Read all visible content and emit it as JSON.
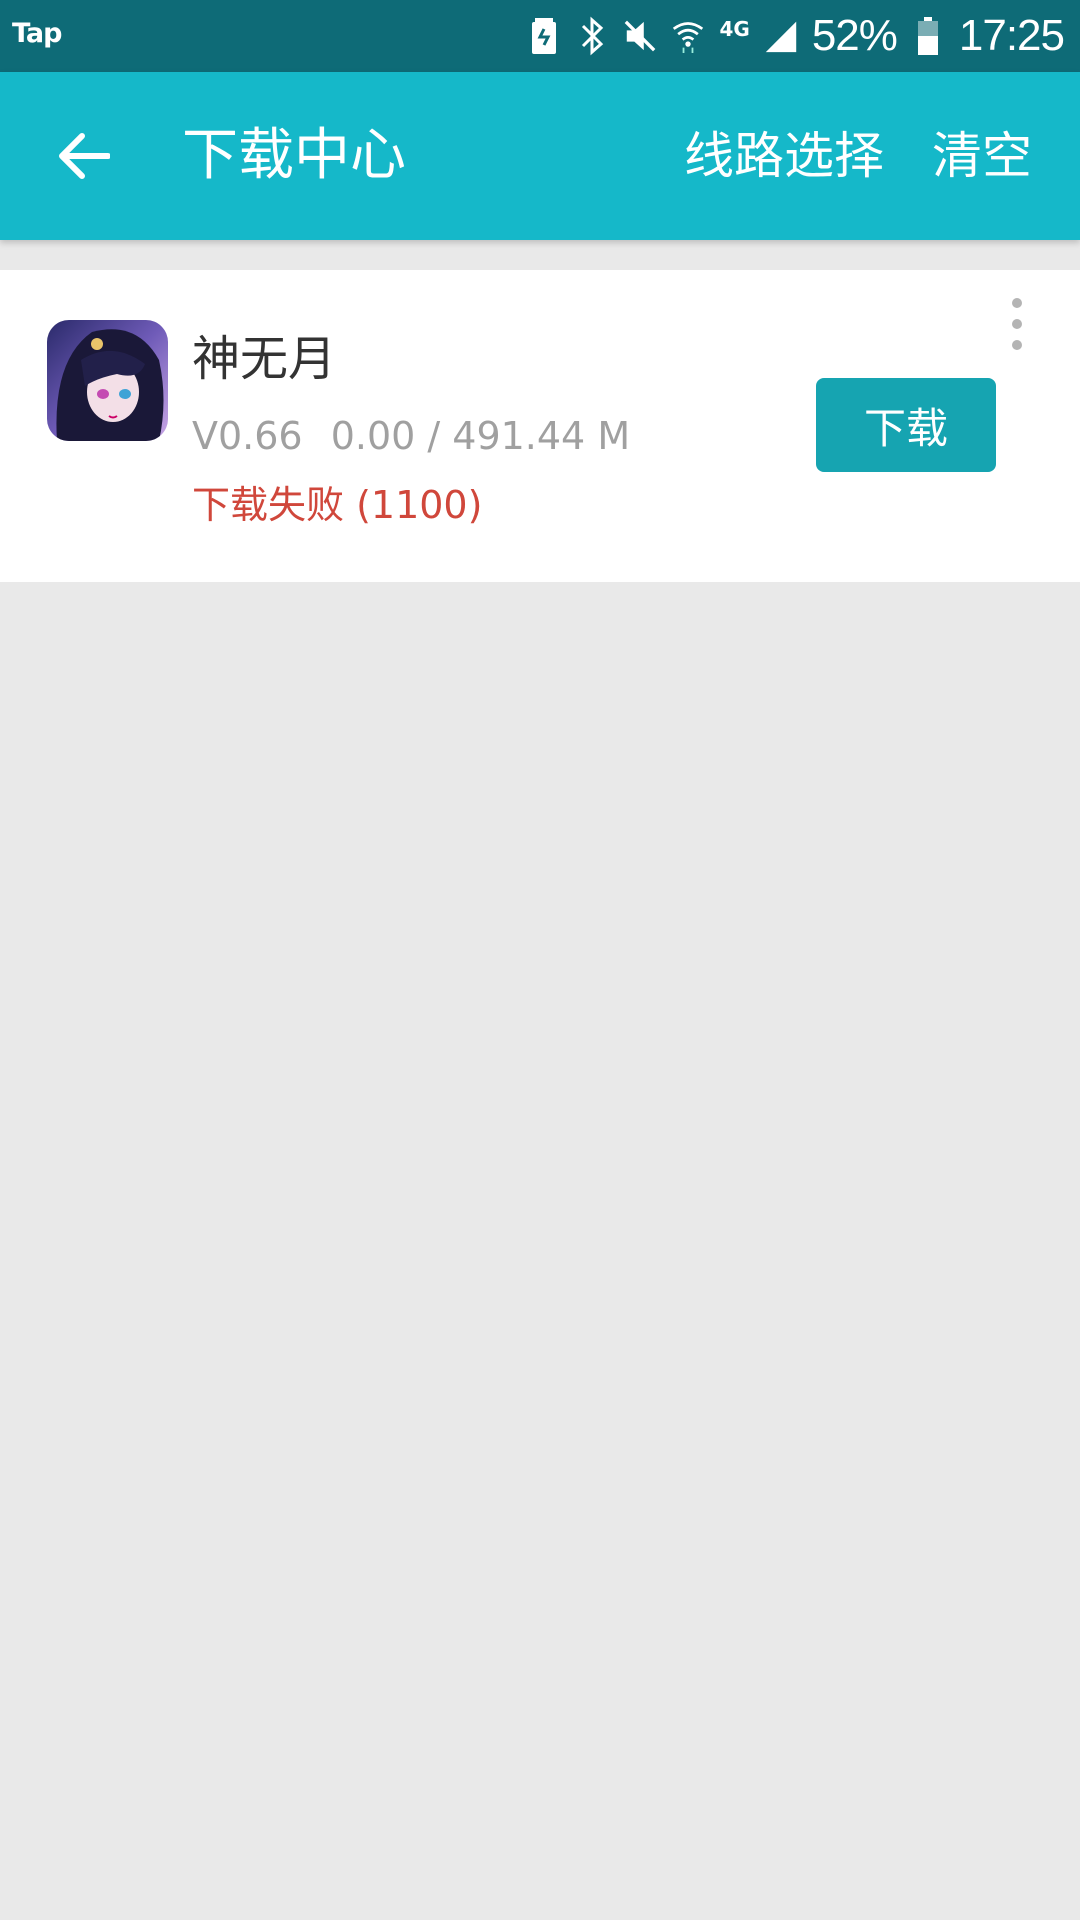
{
  "status_bar": {
    "app": "Tap",
    "network": "4G",
    "battery": "52%",
    "time": "17:25"
  },
  "header": {
    "title": "下载中心",
    "route_select": "线路选择",
    "clear": "清空"
  },
  "downloads": [
    {
      "name": "神无月",
      "version": "V0.66",
      "size": "0.00 / 491.44 M",
      "status": "下载失败 (1100)",
      "action": "下载"
    }
  ],
  "colors": {
    "status_bar": "#0e6b77",
    "app_bar": "#15b8c9",
    "button": "#16a4b1",
    "error": "#d0473b",
    "background": "#e9e9e9"
  }
}
